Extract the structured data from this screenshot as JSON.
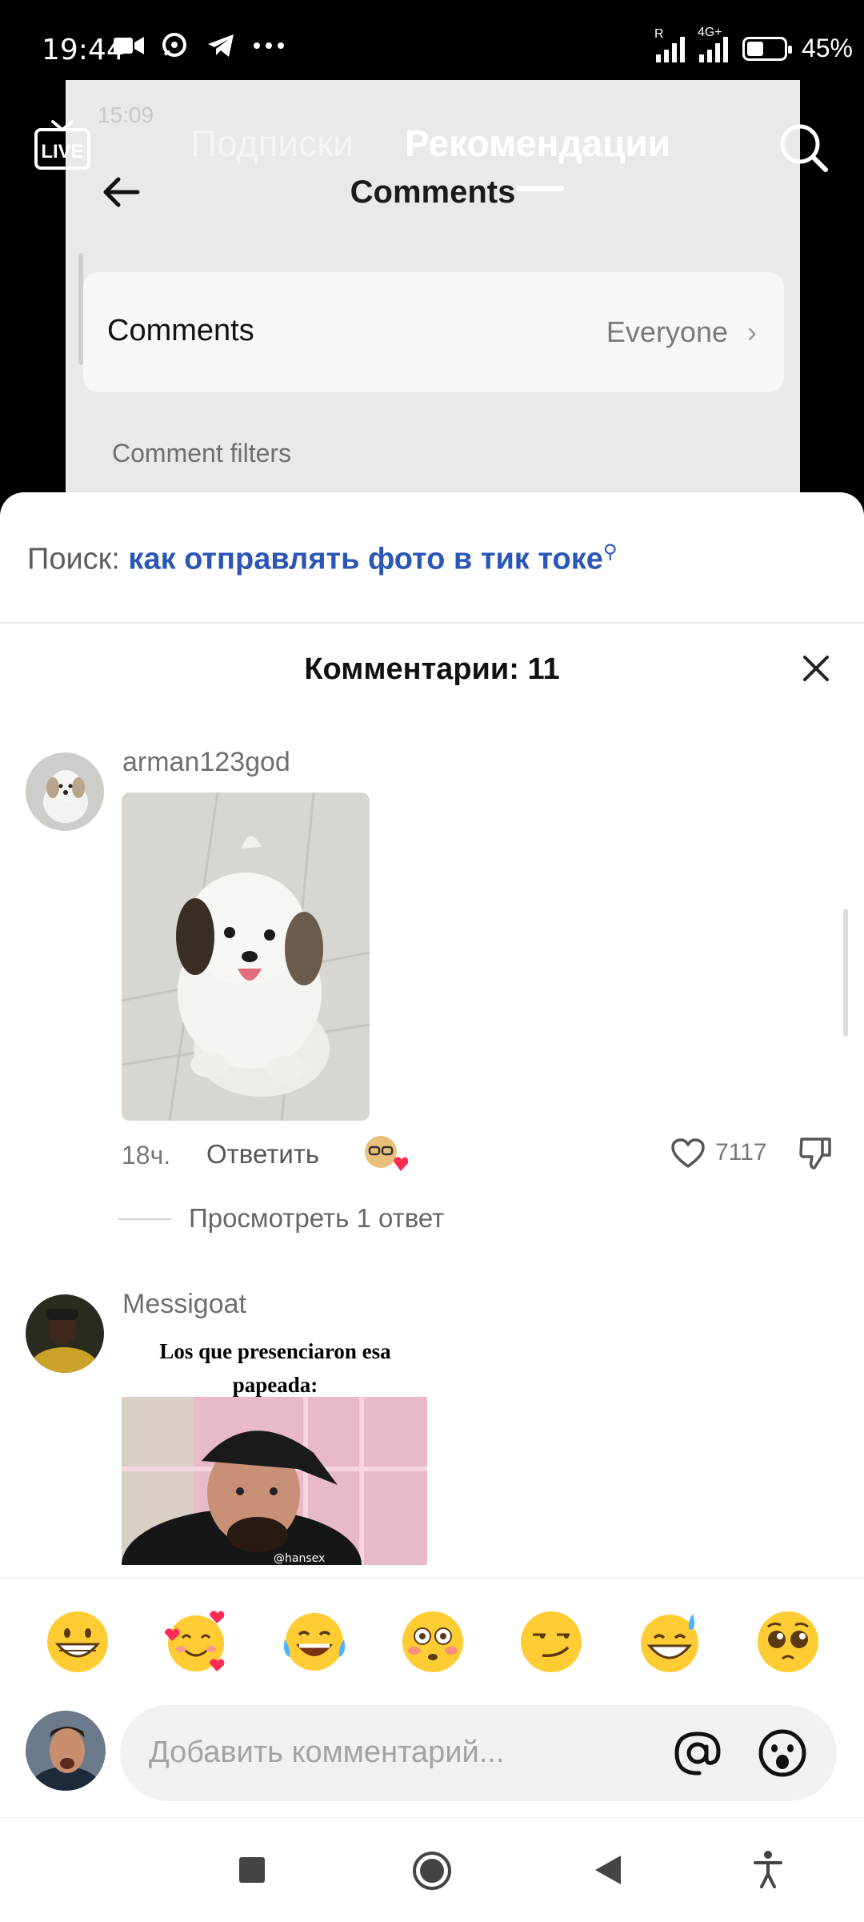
{
  "status_bar": {
    "time": "19:44",
    "battery": "45%",
    "battery_level": 0.45,
    "network_label": "4G+",
    "roaming_label": "R"
  },
  "background_video": {
    "ghost_status": "15:09",
    "title": "Comments",
    "setting_label": "Comments",
    "setting_value": "Everyone",
    "filters_label": "Comment filters"
  },
  "top_nav": {
    "live_label": "LIVE",
    "tab_following": "Подписки",
    "tab_recommended": "Рекомендации"
  },
  "search_suggestion": {
    "prefix": "Поиск:",
    "query": "как отправлять фото в тик токе"
  },
  "comments_sheet": {
    "title": "Комментарии: 11",
    "comments": [
      {
        "username": "arman123god",
        "time": "18ч.",
        "reply_label": "Ответить",
        "likes": "7117",
        "view_replies": "Просмотреть 1 ответ"
      },
      {
        "username": "Messigoat",
        "meme_caption": "Los que presenciaron esa papeada:",
        "watermark": "@hansex"
      }
    ]
  },
  "emoji_bar": [
    "grinning-face",
    "smiling-face-with-hearts",
    "face-with-tears-of-joy",
    "flushed-face",
    "smirking-face",
    "grinning-face-with-sweat",
    "pleading-face"
  ],
  "comment_input": {
    "placeholder": "Добавить комментарий..."
  },
  "colors": {
    "link_blue": "#2a56b9",
    "like_red": "#ff2d55",
    "emoji_yellow": "#ffcc33"
  }
}
